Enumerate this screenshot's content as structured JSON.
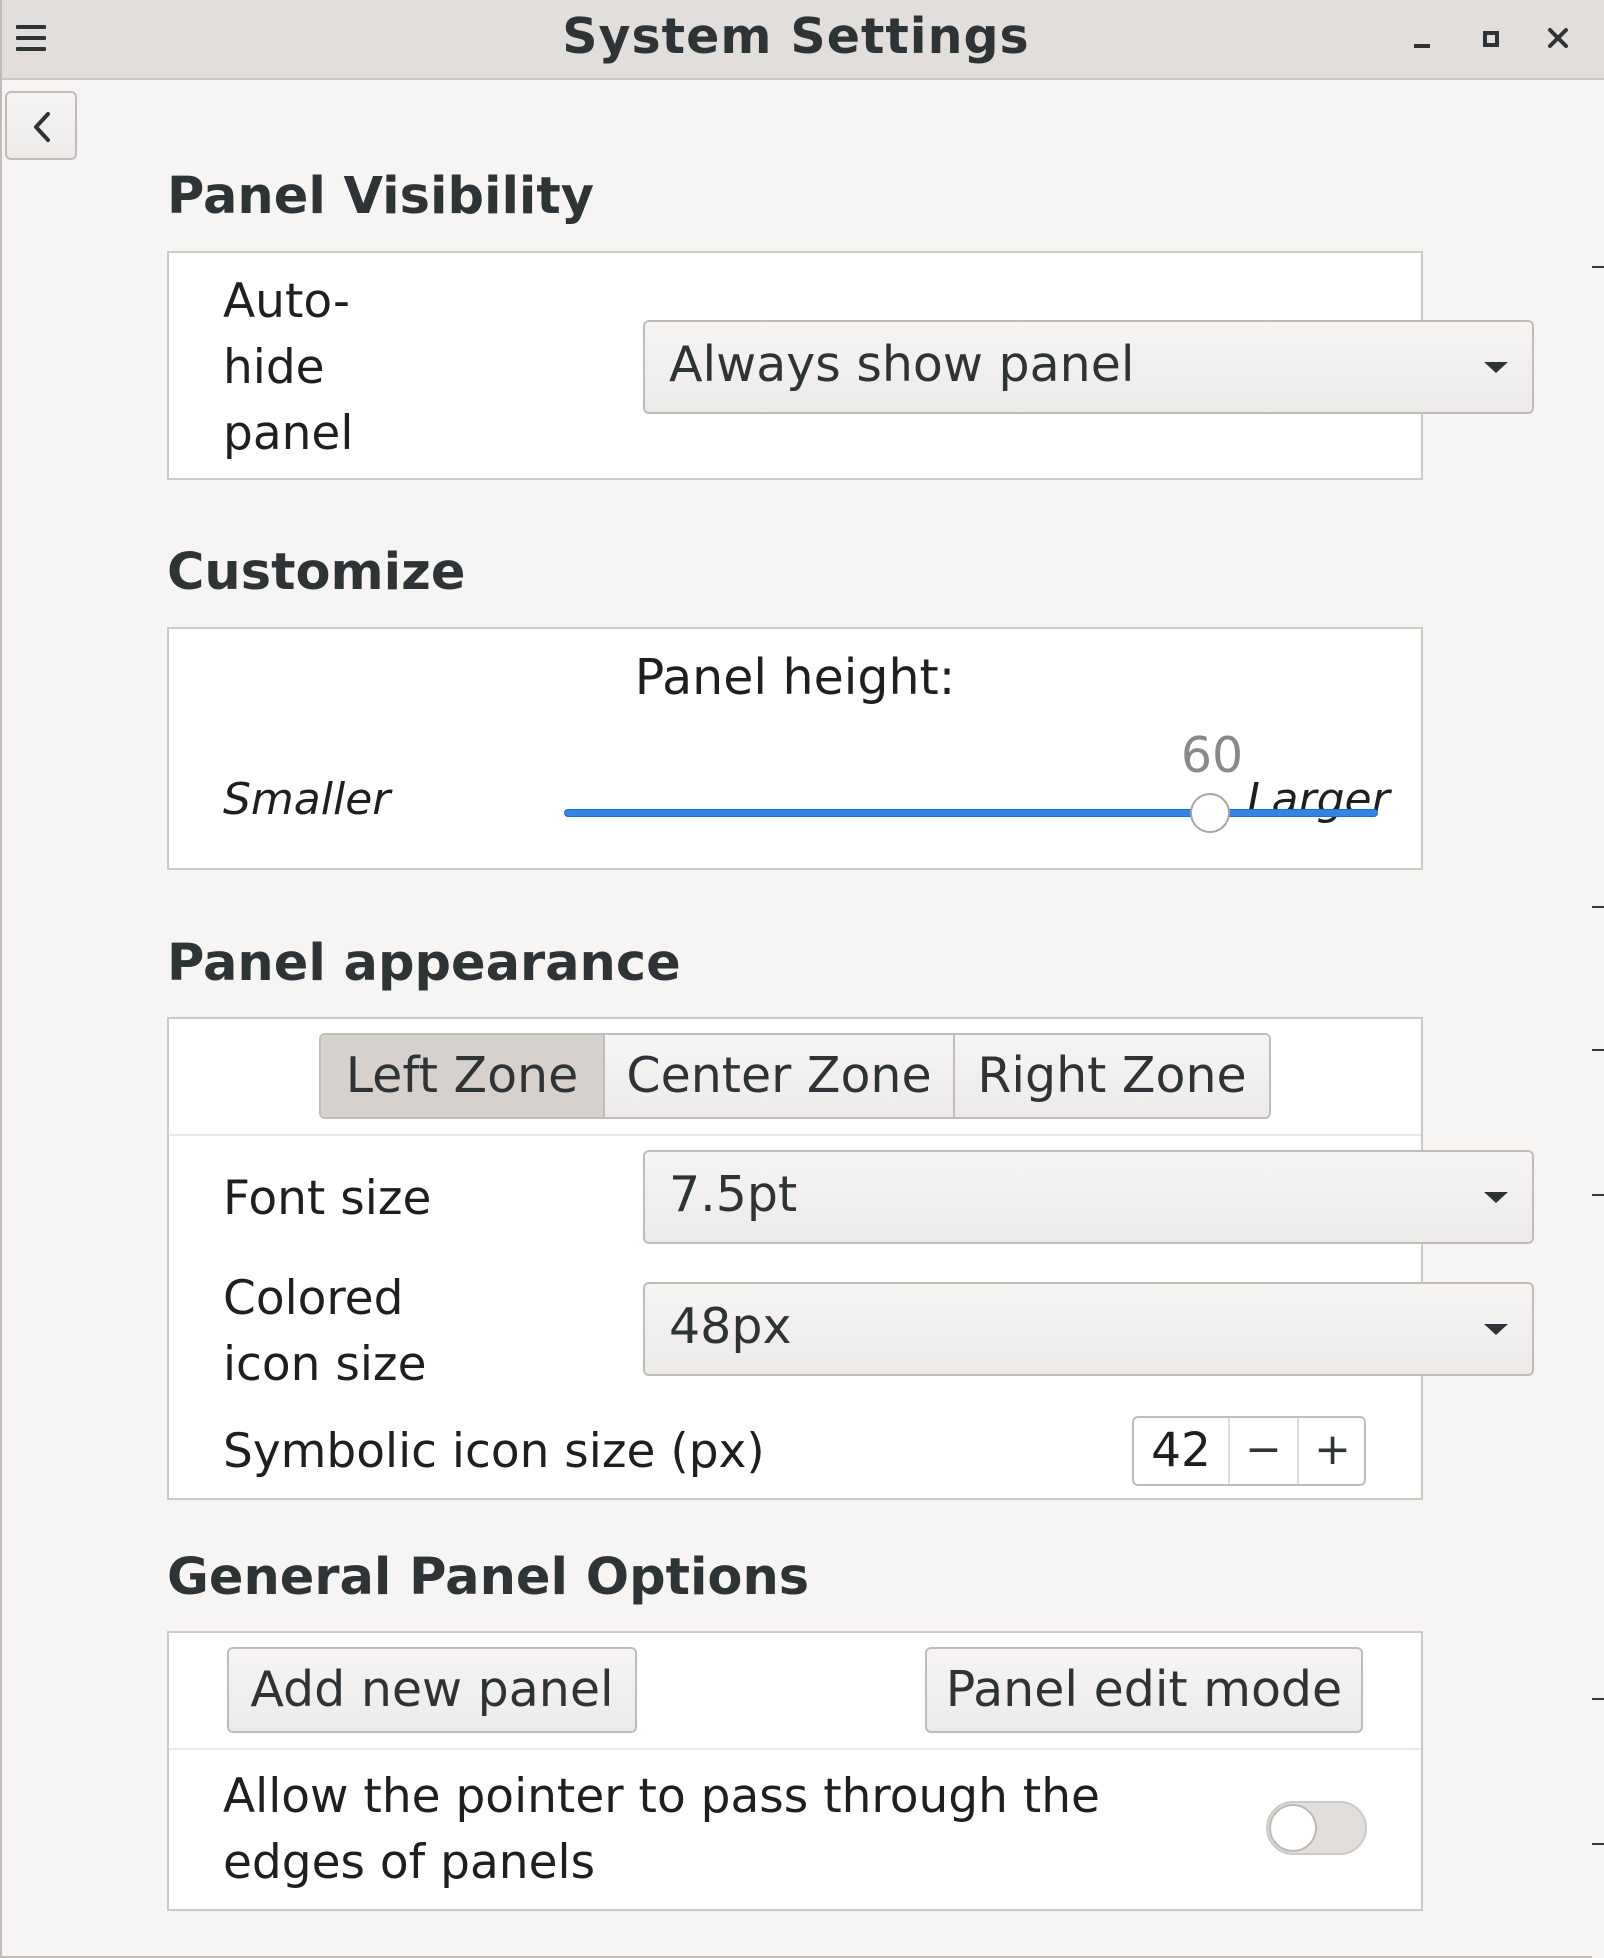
{
  "window": {
    "title": "System Settings"
  },
  "icons": {
    "menu": "hamburger-menu-icon",
    "minimize": "minimize-icon",
    "maximize": "maximize-icon",
    "close": "close-icon",
    "back": "chevron-left-icon",
    "combo_arrow": "dropdown-arrow-icon"
  },
  "panel_visibility": {
    "title": "Panel Visibility",
    "autohide_label_line1": "Auto-",
    "autohide_label_line2": "hide",
    "autohide_label_line3": "panel",
    "autohide_value": "Always show panel"
  },
  "customize": {
    "title": "Customize",
    "height_label": "Panel height:",
    "smaller_label": "Smaller",
    "larger_label": "Larger",
    "height_value": "60",
    "slider_fraction": 1.0
  },
  "panel_appearance": {
    "title": "Panel appearance",
    "tabs": [
      "Left Zone",
      "Center Zone",
      "Right Zone"
    ],
    "active_tab": "Left Zone",
    "font_size_label": "Font size",
    "font_size_value": "7.5pt",
    "colored_icon_label_line1": "Colored",
    "colored_icon_label_line2": "icon size",
    "colored_icon_value": "48px",
    "symbolic_icon_label": "Symbolic icon size (px)",
    "symbolic_icon_value": "42",
    "decrement_symbol": "−",
    "increment_symbol": "+"
  },
  "general_options": {
    "title": "General Panel Options",
    "add_panel_label": "Add new panel",
    "edit_mode_label": "Panel edit mode",
    "pointer_label_line1": "Allow the pointer to pass through the",
    "pointer_label_line2": "edges of panels",
    "pointer_toggle_on": false
  },
  "colors": {
    "accent": "#3584e4",
    "window_bg": "#f6f5f4",
    "titlebar_bg": "#e1dedb"
  }
}
